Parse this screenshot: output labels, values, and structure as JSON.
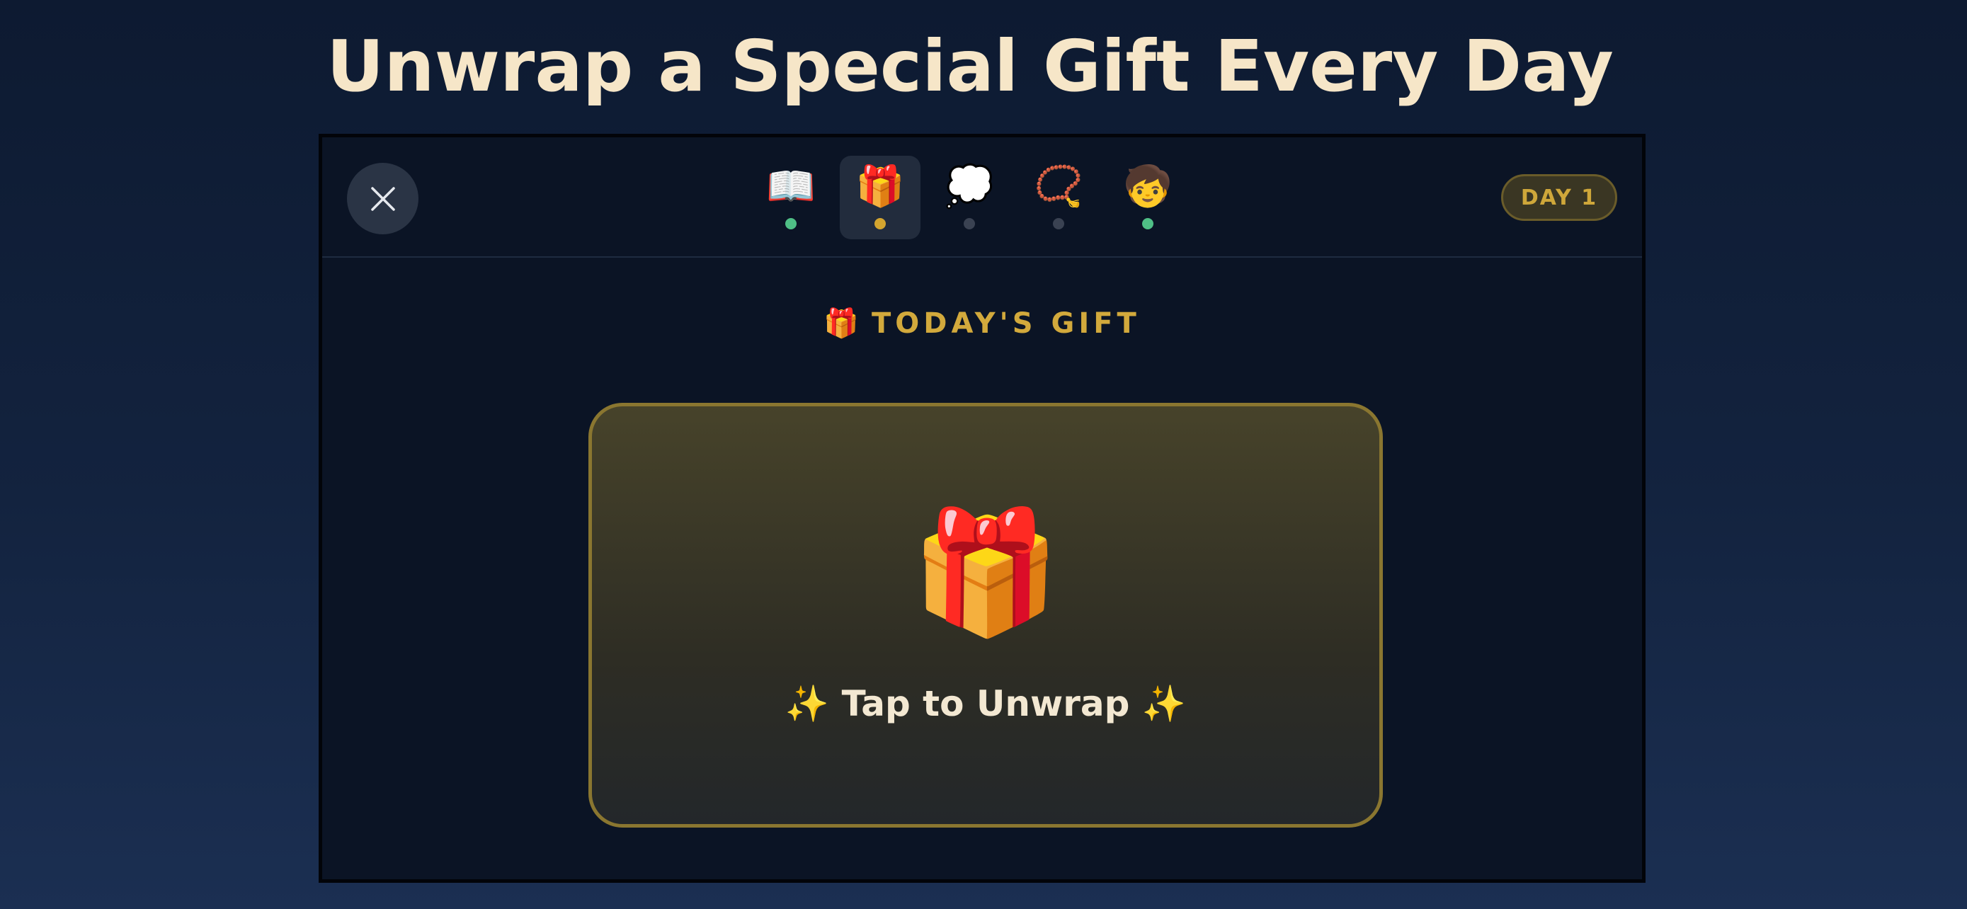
{
  "headline": "Unwrap a Special Gift Every Day",
  "topbar": {
    "close_icon": "close-icon",
    "tabs": [
      {
        "emoji": "📖",
        "name": "book",
        "dot_color": "#4fbf86"
      },
      {
        "emoji": "🎁",
        "name": "gift",
        "dot_color": "#d4a52f",
        "active": true
      },
      {
        "emoji": "💭",
        "name": "thought",
        "dot_color": "#3a4252"
      },
      {
        "emoji": "📿",
        "name": "prayer-beads",
        "dot_color": "#3a4252"
      },
      {
        "emoji": "🧒",
        "name": "child",
        "dot_color": "#4fbf86"
      }
    ],
    "day_badge": "DAY 1"
  },
  "section": {
    "icon": "🎁",
    "title": "TODAY'S GIFT"
  },
  "gift_card": {
    "emoji": "🎁",
    "label": "✨ Tap to Unwrap ✨"
  },
  "colors": {
    "accent_gold": "#d2a93c",
    "headline": "#f6e6c8",
    "card_border": "#8a7630",
    "dot_done": "#4fbf86",
    "dot_active": "#d4a52f",
    "dot_pending": "#3a4252"
  }
}
